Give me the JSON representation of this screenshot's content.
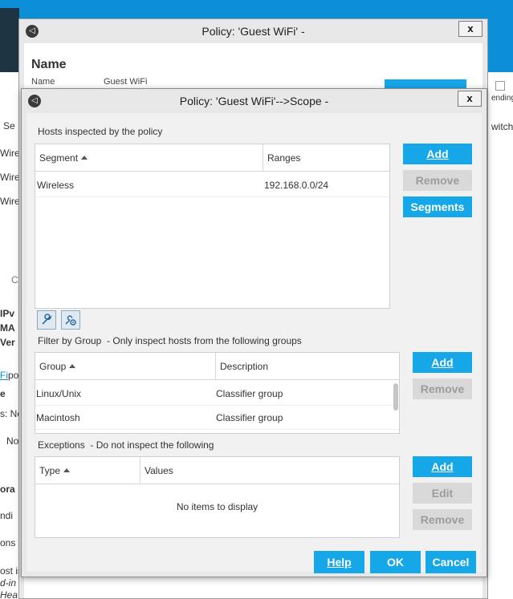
{
  "background": {
    "rows": [
      "Se",
      "Wire",
      "Wire",
      "Wire"
    ],
    "tab_fragment": "C",
    "side_texts": [
      "IPv",
      "MA",
      "Ver",
      "Fi",
      "po",
      "e",
      "s: No",
      "No",
      "ora",
      "ndi",
      "ons",
      "ost is",
      "d-in",
      "Hea"
    ],
    "right_texts": [
      "ending",
      "witch"
    ]
  },
  "outer_dialog": {
    "title": "Policy: 'Guest WiFi' -",
    "close_label": "x",
    "name_heading": "Name",
    "name_label": "Name",
    "name_value": "Guest WiFi"
  },
  "inner_dialog": {
    "title": "Policy: 'Guest WiFi'-->Scope -",
    "close_label": "x",
    "hosts": {
      "label": "Hosts inspected by the policy",
      "columns": [
        "Segment",
        "Ranges"
      ],
      "rows": [
        {
          "segment": "Wireless",
          "ranges": "192.168.0.0/24"
        }
      ],
      "buttons": {
        "add": "Add",
        "remove": "Remove",
        "segments": "Segments"
      }
    },
    "filter": {
      "label": "Filter by Group",
      "hint": "- Only inspect hosts from the following groups",
      "columns": [
        "Group",
        "Description"
      ],
      "rows": [
        {
          "group": "Linux/Unix",
          "description": "Classifier group"
        },
        {
          "group": "Macintosh",
          "description": "Classifier group"
        }
      ],
      "buttons": {
        "add": "Add",
        "remove": "Remove"
      }
    },
    "exceptions": {
      "label": "Exceptions",
      "hint": "- Do not inspect the following",
      "columns": [
        "Type",
        "Values"
      ],
      "empty_text": "No items to display",
      "buttons": {
        "add": "Add",
        "edit": "Edit",
        "remove": "Remove"
      }
    },
    "footer": {
      "help": "Help",
      "ok": "OK",
      "cancel": "Cancel"
    }
  },
  "colors": {
    "accent": "#16a7e9",
    "disabled_bg": "#d9d9d9",
    "disabled_text": "#9c9c9c"
  },
  "icons": [
    "settings-icon",
    "tool-icon",
    "group-settings-icon",
    "close-icon",
    "sort-ascending-icon"
  ]
}
